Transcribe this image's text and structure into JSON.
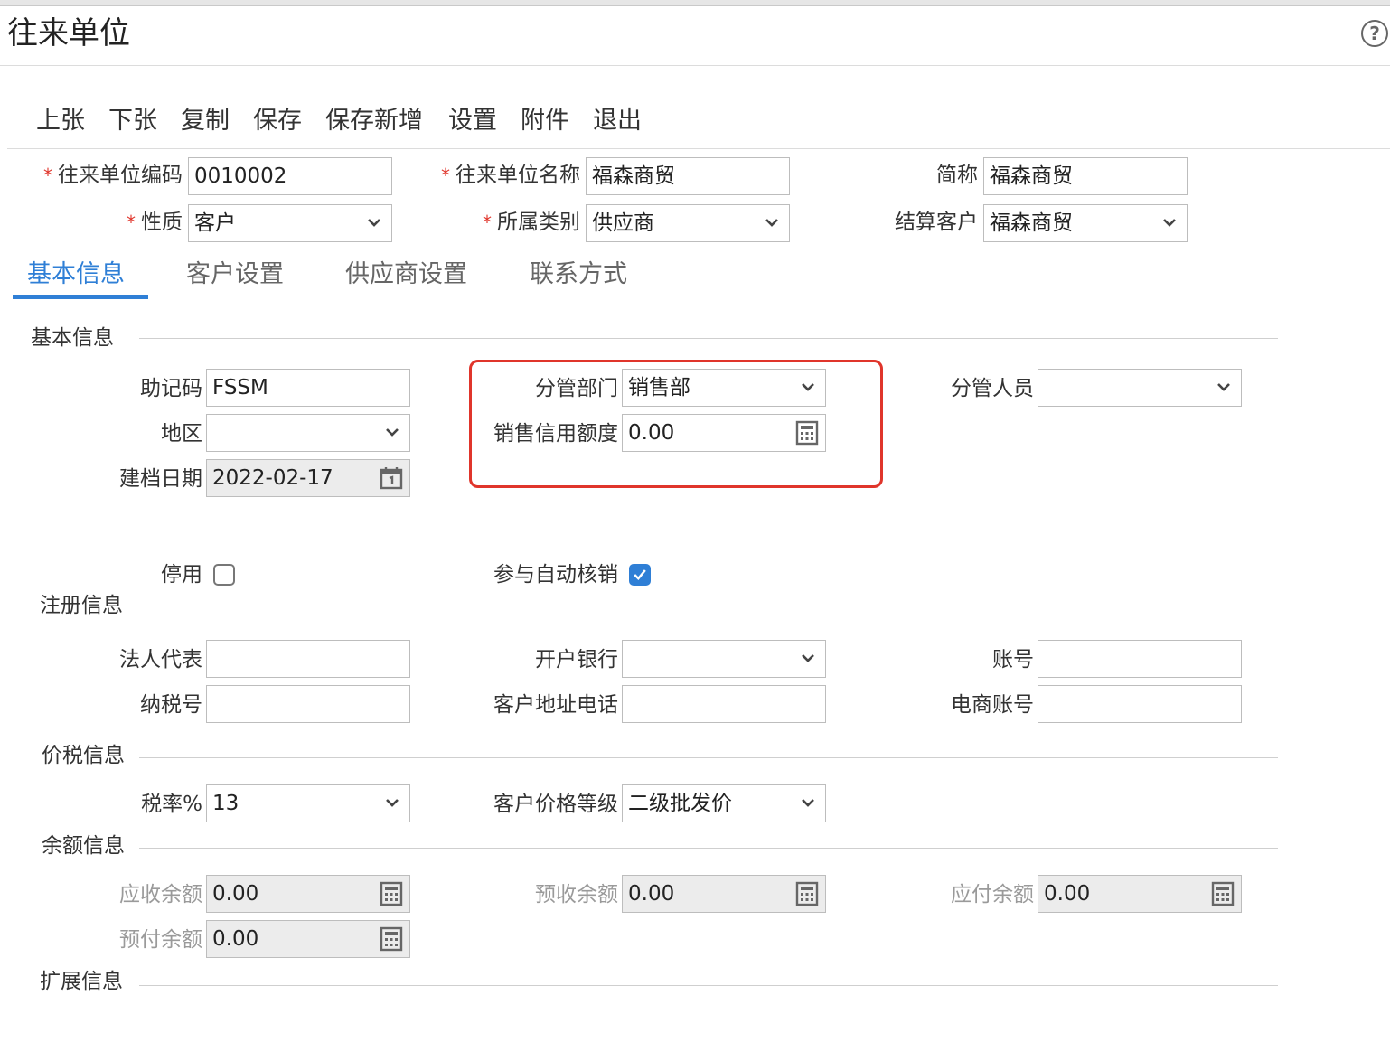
{
  "window": {
    "title": "往来单位"
  },
  "toolbar": [
    {
      "id": "prev",
      "label": "上张"
    },
    {
      "id": "next",
      "label": "下张"
    },
    {
      "id": "copy",
      "label": "复制"
    },
    {
      "id": "save",
      "label": "保存"
    },
    {
      "id": "save_new",
      "label": "保存新增"
    },
    {
      "id": "settings",
      "label": "设置"
    },
    {
      "id": "attach",
      "label": "附件"
    },
    {
      "id": "exit",
      "label": "退出"
    }
  ],
  "header": {
    "code": {
      "label": "往来单位编码",
      "value": "0010002",
      "required": true
    },
    "name": {
      "label": "往来单位名称",
      "value": "福森商贸",
      "required": true
    },
    "short": {
      "label": "简称",
      "value": "福森商贸"
    },
    "nature": {
      "label": "性质",
      "value": "客户",
      "required": true
    },
    "category": {
      "label": "所属类别",
      "value": "供应商",
      "required": true
    },
    "settle": {
      "label": "结算客户",
      "value": "福森商贸"
    }
  },
  "tabs": [
    {
      "label": "基本信息",
      "active": true
    },
    {
      "label": "客户设置",
      "active": false
    },
    {
      "label": "供应商设置",
      "active": false
    },
    {
      "label": "联系方式",
      "active": false
    }
  ],
  "basic": {
    "section_title": "基本信息",
    "mnemonic": {
      "label": "助记码",
      "value": "FSSM"
    },
    "region": {
      "label": "地区",
      "value": ""
    },
    "created": {
      "label": "建档日期",
      "value": "2022-02-17"
    },
    "dept": {
      "label": "分管部门",
      "value": "销售部"
    },
    "credit": {
      "label": "销售信用额度",
      "value": "0.00"
    },
    "staff": {
      "label": "分管人员",
      "value": ""
    },
    "disabled": {
      "label": "停用",
      "checked": false
    },
    "auto_writeoff": {
      "label": "参与自动核销",
      "checked": true
    }
  },
  "registration": {
    "section_title": "注册信息",
    "legal_rep": {
      "label": "法人代表",
      "value": ""
    },
    "bank": {
      "label": "开户银行",
      "value": ""
    },
    "account": {
      "label": "账号",
      "value": ""
    },
    "tax_no": {
      "label": "纳税号",
      "value": ""
    },
    "addr_phone": {
      "label": "客户地址电话",
      "value": ""
    },
    "ecom_account": {
      "label": "电商账号",
      "value": ""
    }
  },
  "tax": {
    "section_title": "价税信息",
    "rate": {
      "label": "税率%",
      "value": "13"
    },
    "price_level": {
      "label": "客户价格等级",
      "value": "二级批发价"
    }
  },
  "balance": {
    "section_title": "余额信息",
    "receivable": {
      "label": "应收余额",
      "value": "0.00"
    },
    "prepaid_recv": {
      "label": "预收余额",
      "value": "0.00"
    },
    "payable": {
      "label": "应付余额",
      "value": "0.00"
    },
    "prepaid_pay": {
      "label": "预付余额",
      "value": "0.00"
    }
  },
  "extension": {
    "section_title": "扩展信息"
  },
  "colors": {
    "accent": "#2f7fd6",
    "required": "#e0352b",
    "highlight_box": "#e0352b"
  },
  "icons": {
    "help": "question-circle-icon",
    "dropdown": "chevron-down-icon",
    "calculator": "calculator-icon",
    "calendar": "calendar-icon",
    "check": "checkmark-icon"
  }
}
